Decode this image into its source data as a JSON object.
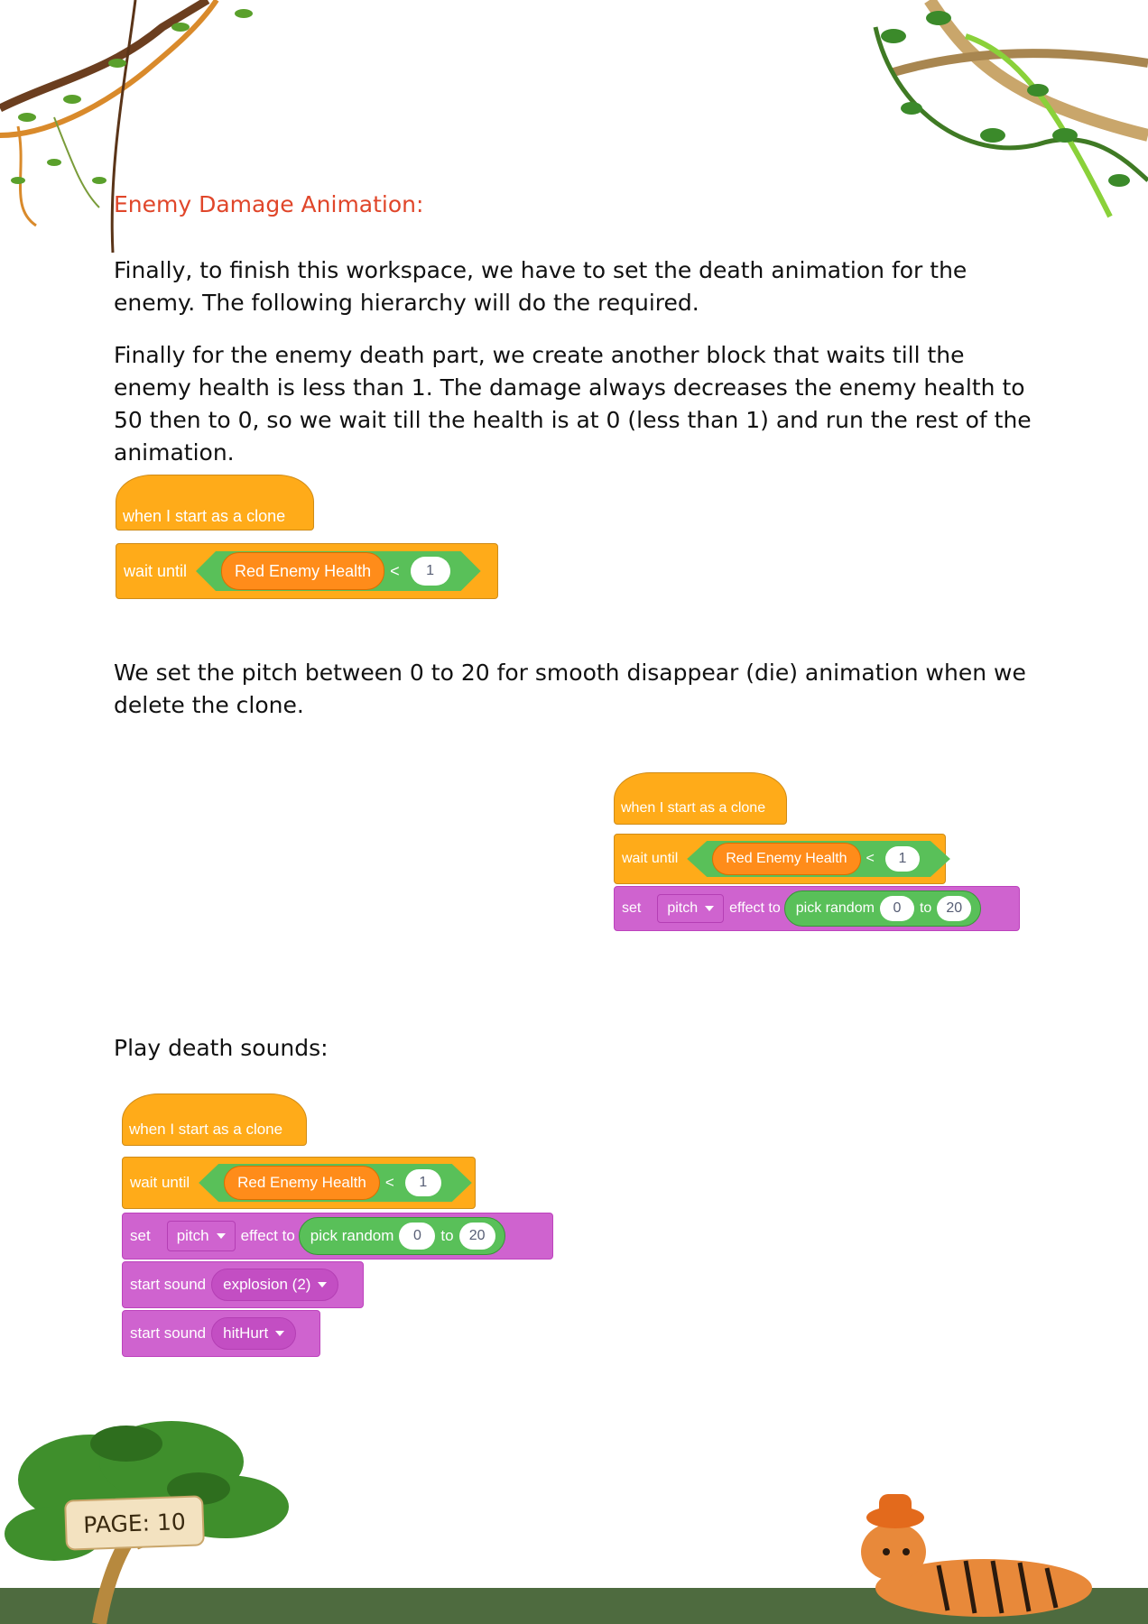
{
  "heading": "Enemy Damage Animation:",
  "paragraphs": [
    "Finally, to finish this workspace, we have to set the death animation for the enemy. The following hierarchy will do the required.",
    "Finally for the enemy death part, we create another block that waits till the enemy health is less than 1. The damage always decreases the enemy health to 50 then to 0, so we wait till the health is at 0 (less than 1) and run the rest of the animation.",
    "We set the pitch between 0 to 20 for smooth disappear (die) animation when we delete the clone."
  ],
  "play_label": "Play death sounds:",
  "blocks": {
    "hat": "when I start as a clone",
    "wait": "wait until",
    "variable": "Red Enemy Health",
    "lt": "<",
    "value": "1",
    "set": "set",
    "pitch": "pitch",
    "effect_to": "effect to",
    "pick_random": "pick random",
    "min": "0",
    "to": "to",
    "max": "20",
    "start_sound": "start sound",
    "sound1": "explosion (2)",
    "sound2": "hitHurt"
  },
  "page_label": "PAGE: 10",
  "colors": {
    "heading": "#e0462a",
    "event": "#ffab19",
    "operator": "#59c059",
    "sound": "#cf63cf",
    "variable": "#ff8c1a"
  }
}
